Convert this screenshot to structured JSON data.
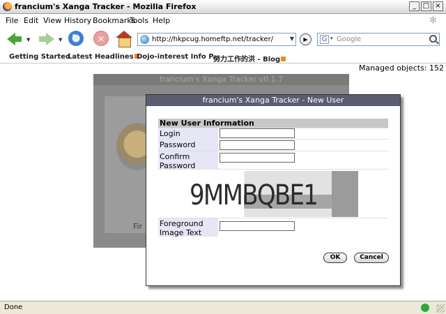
{
  "window": {
    "title": "francium's Xanga Tracker - Mozilla Firefox",
    "controls": [
      "_",
      "□",
      "×"
    ]
  },
  "menu": [
    "File",
    "Edit",
    "View",
    "History",
    "Bookmarks",
    "Tools",
    "Help"
  ],
  "navigation": {
    "url": "http://hkpcug.homeftp.net/tracker/",
    "search_placeholder": "Google",
    "search_engine_letter": "G",
    "icons": [
      "back-icon",
      "forward-icon",
      "reload-icon",
      "stop-icon",
      "home-icon",
      "go-icon",
      "search-icon"
    ]
  },
  "bookmarks": [
    "Getting Started",
    "Latest Headlines",
    "Dojo-interest Info P...",
    "努力工作的洪 - Blog"
  ],
  "page": {
    "managed_objects": "Managed objects: 152",
    "background_window": {
      "title": "francium's Xanga Tracker v0.1.7",
      "fragment": "Fir"
    },
    "dialog": {
      "title": "francium's Xanga Tracker - New User",
      "section_header": "New User Information",
      "fields": {
        "login": "Login",
        "password": "Password",
        "confirm_password_1": "Confirm",
        "confirm_password_2": "Password",
        "foreground_1": "Foreground",
        "foreground_2": "Image Text"
      },
      "captcha_text": "9MMBQBE1",
      "ok": "OK",
      "cancel": "Cancel"
    }
  },
  "status": {
    "text": "Done"
  }
}
